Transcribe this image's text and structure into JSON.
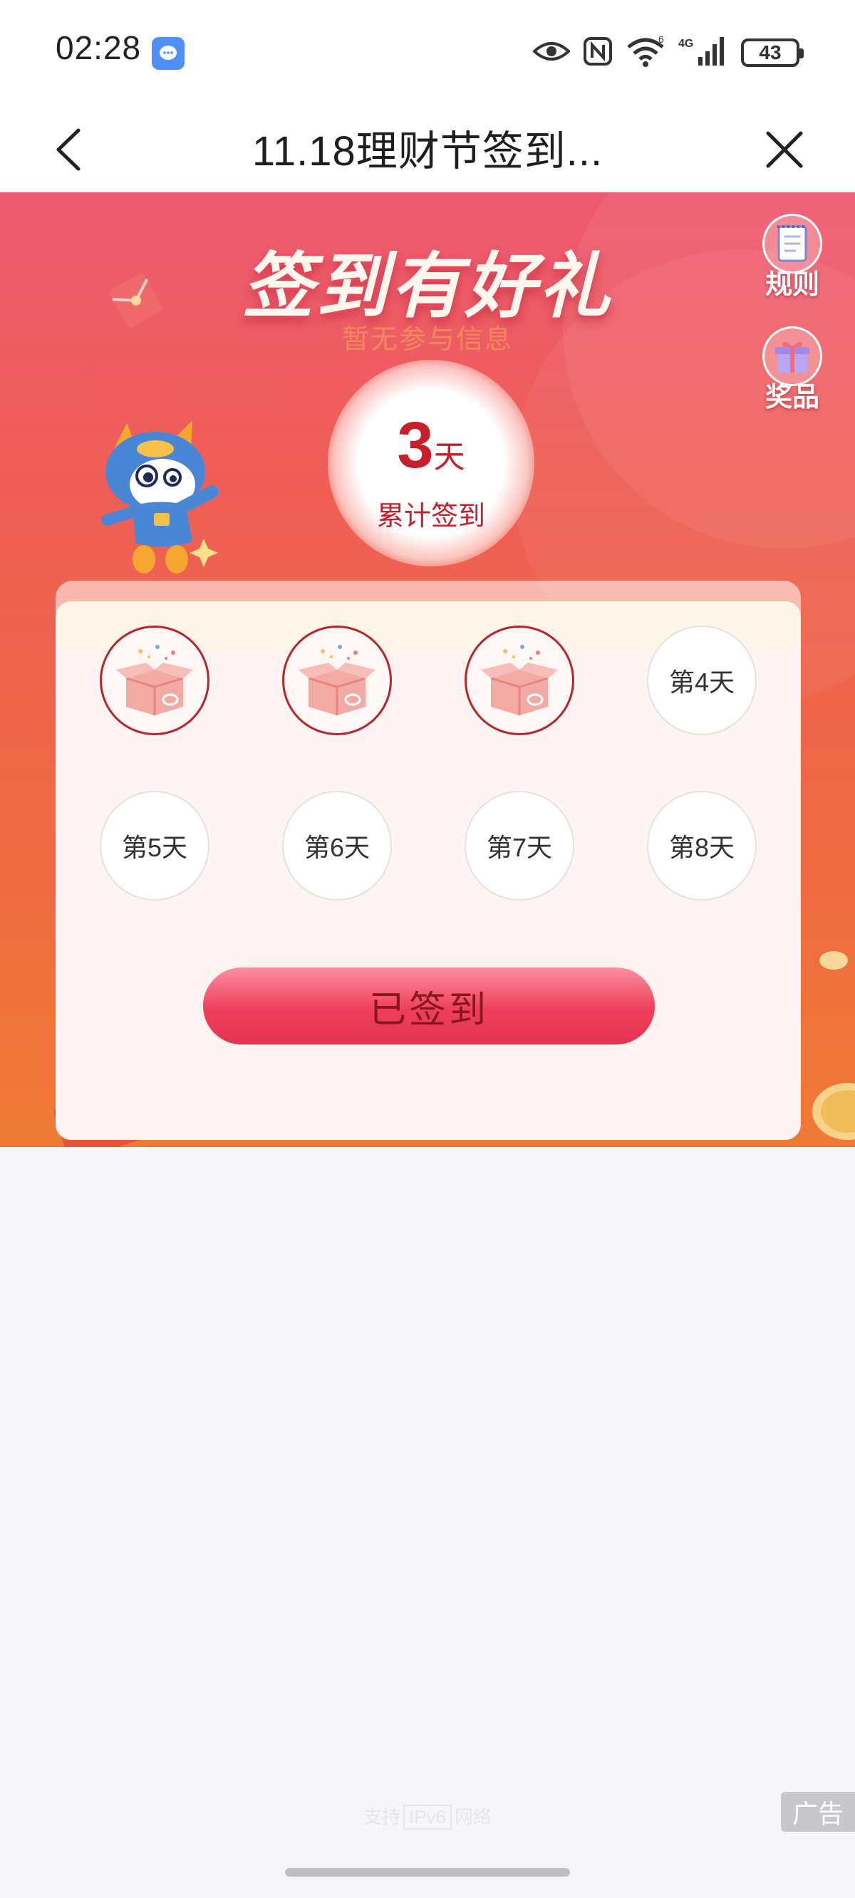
{
  "status_bar": {
    "time": "02:28",
    "battery": "43",
    "network": "4G",
    "icons": [
      "message-app-icon",
      "eye-icon",
      "nfc-icon",
      "wifi-icon",
      "signal-icon",
      "battery-icon"
    ]
  },
  "header": {
    "title": "11.18理财节签到...",
    "back_icon": "chevron-left-icon",
    "close_icon": "close-icon"
  },
  "hero": {
    "title": "签到有好礼",
    "subtitle": "暂无参与信息",
    "days_count": "3",
    "days_unit": "天",
    "days_label": "累计签到"
  },
  "side_buttons": [
    {
      "label": "规则",
      "icon": "notebook-icon"
    },
    {
      "label": "奖品",
      "icon": "gift-icon"
    }
  ],
  "checkin": {
    "days": [
      {
        "label": "",
        "checked": true
      },
      {
        "label": "",
        "checked": true
      },
      {
        "label": "",
        "checked": true
      },
      {
        "label": "第4天",
        "checked": false
      },
      {
        "label": "第5天",
        "checked": false
      },
      {
        "label": "第6天",
        "checked": false
      },
      {
        "label": "第7天",
        "checked": false
      },
      {
        "label": "第8天",
        "checked": false
      }
    ],
    "button_label": "已签到"
  },
  "footer": {
    "support_prefix": "支持",
    "support_tag": "IPv6",
    "support_suffix": "网络",
    "ad_label": "广告"
  },
  "colors": {
    "accent_red": "#c7202a",
    "hero_top": "#ee5a72",
    "hero_bottom": "#ef7a35",
    "button_pink": "#ef3e5c"
  }
}
